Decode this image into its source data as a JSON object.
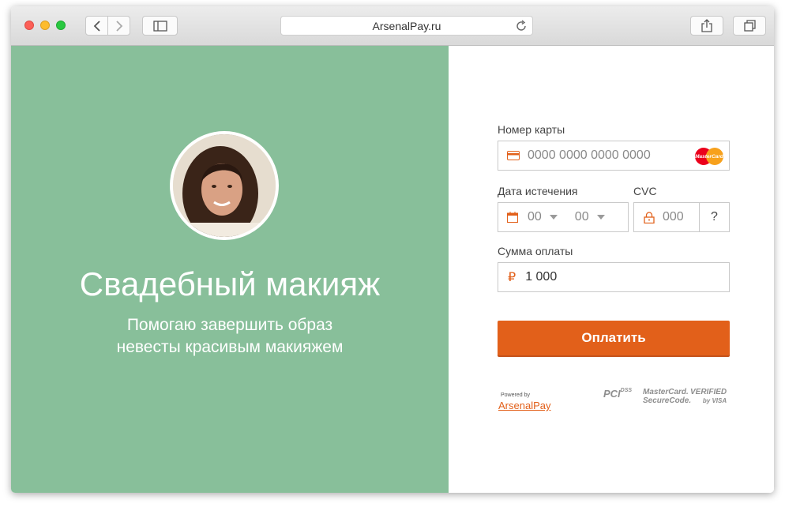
{
  "browser": {
    "address": "ArsenalPay.ru",
    "icons": {
      "back": "chevron-left-icon",
      "forward": "chevron-right-icon",
      "sidebar": "sidebar-icon",
      "reload": "reload-icon",
      "share": "share-icon",
      "tabs": "tabs-icon"
    }
  },
  "left": {
    "title": "Свадебный макияж",
    "subtitle": "Помогаю завершить образ\nневесты  красивым макияжем",
    "background_color": "#88bf9a"
  },
  "form": {
    "card": {
      "label": "Номер карты",
      "placeholder": "0000 0000 0000 0000",
      "brand_logo": "MasterCard"
    },
    "expiry": {
      "label": "Дата истечения",
      "month": "00",
      "year": "00"
    },
    "cvc": {
      "label": "CVC",
      "placeholder": "000",
      "help": "?"
    },
    "amount": {
      "label": "Сумма оплаты",
      "currency_symbol": "₽",
      "value": "1 000"
    },
    "pay_button": "Оплатить",
    "accent_color": "#e2601a"
  },
  "footer": {
    "powered_by": "Powered by",
    "provider": "ArsenalPay",
    "badges": {
      "pci": "PCI",
      "pci_sub": "DSS",
      "mastercard_line1": "MasterCard.",
      "mastercard_line2": "SecureCode.",
      "verified_line1": "VERIFIED",
      "verified_line2": "by VISA"
    }
  }
}
